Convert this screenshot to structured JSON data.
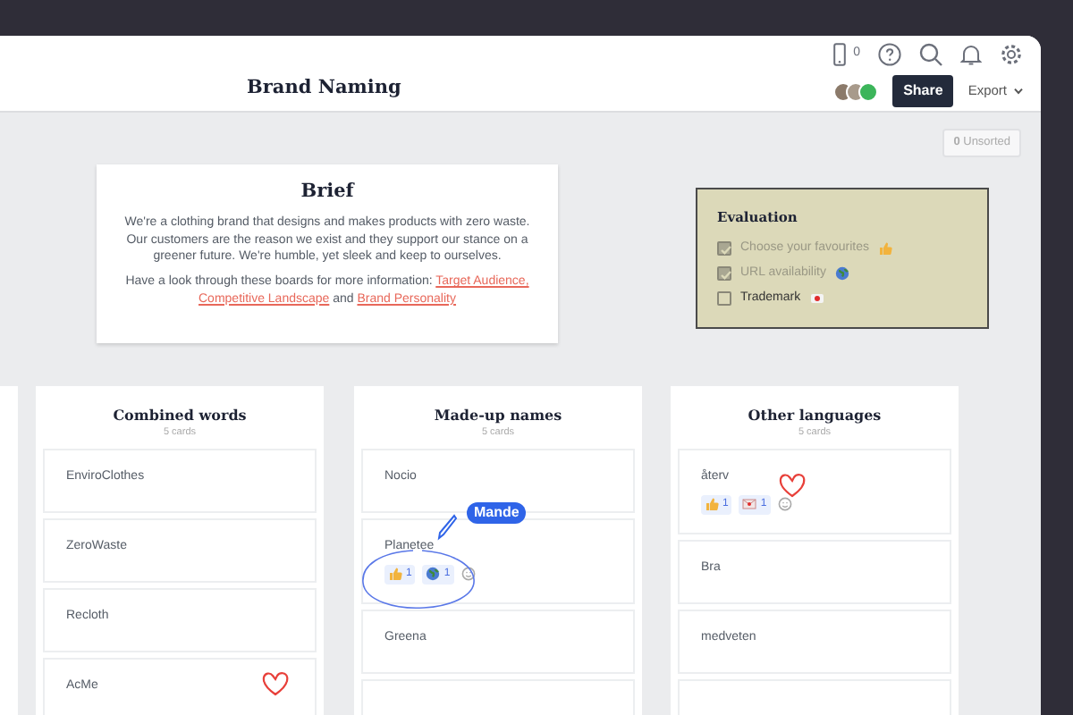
{
  "header": {
    "title": "Brand Naming",
    "device_count": "0",
    "share": "Share",
    "export": "Export"
  },
  "unsorted": {
    "count": "0",
    "label": "Unsorted"
  },
  "brief": {
    "title": "Brief",
    "text": "We're a clothing brand that designs and makes products with zero waste. Our customers are the reason we exist and they support our stance on a greener future. We're humble, yet sleek and keep to ourselves.",
    "links_intro": "Have a look through these boards for more information:",
    "links": [
      "Target Audience,",
      "Competitive Landscape",
      "Brand Personality"
    ],
    "joiner": "and"
  },
  "evaluation": {
    "title": "Evaluation",
    "items": [
      {
        "label": "Choose your favourites",
        "checked": true,
        "kind": "thumbs-up"
      },
      {
        "label": "URL availability",
        "checked": true,
        "kind": "globe"
      },
      {
        "label": "Trademark",
        "checked": false,
        "kind": "stamp"
      }
    ]
  },
  "columns": [
    {
      "title": "Combined words",
      "count": "5 cards",
      "cards": [
        {
          "text": "EnviroClothes"
        },
        {
          "text": "ZeroWaste"
        },
        {
          "text": "Recloth"
        },
        {
          "text": "AcMe",
          "heart": true
        }
      ]
    },
    {
      "title": "Made-up names",
      "count": "5 cards",
      "cards": [
        {
          "text": "Nocio"
        },
        {
          "text": "Planetee",
          "reactions": [
            {
              "kind": "thumbs-up",
              "count": "1"
            },
            {
              "kind": "globe",
              "count": "1"
            }
          ],
          "circled": true
        },
        {
          "text": "Greena"
        },
        {
          "cut_off": true
        }
      ]
    },
    {
      "title": "Other languages",
      "count": "5 cards",
      "cards": [
        {
          "text": "återv",
          "heart": true,
          "reactions": [
            {
              "kind": "thumbs-up",
              "count": "1"
            },
            {
              "kind": "letter",
              "count": "1"
            }
          ]
        },
        {
          "text": "Bra"
        },
        {
          "text": "medveten"
        },
        {
          "cut_off": true
        }
      ]
    }
  ],
  "cursor": {
    "label": "Mande"
  }
}
